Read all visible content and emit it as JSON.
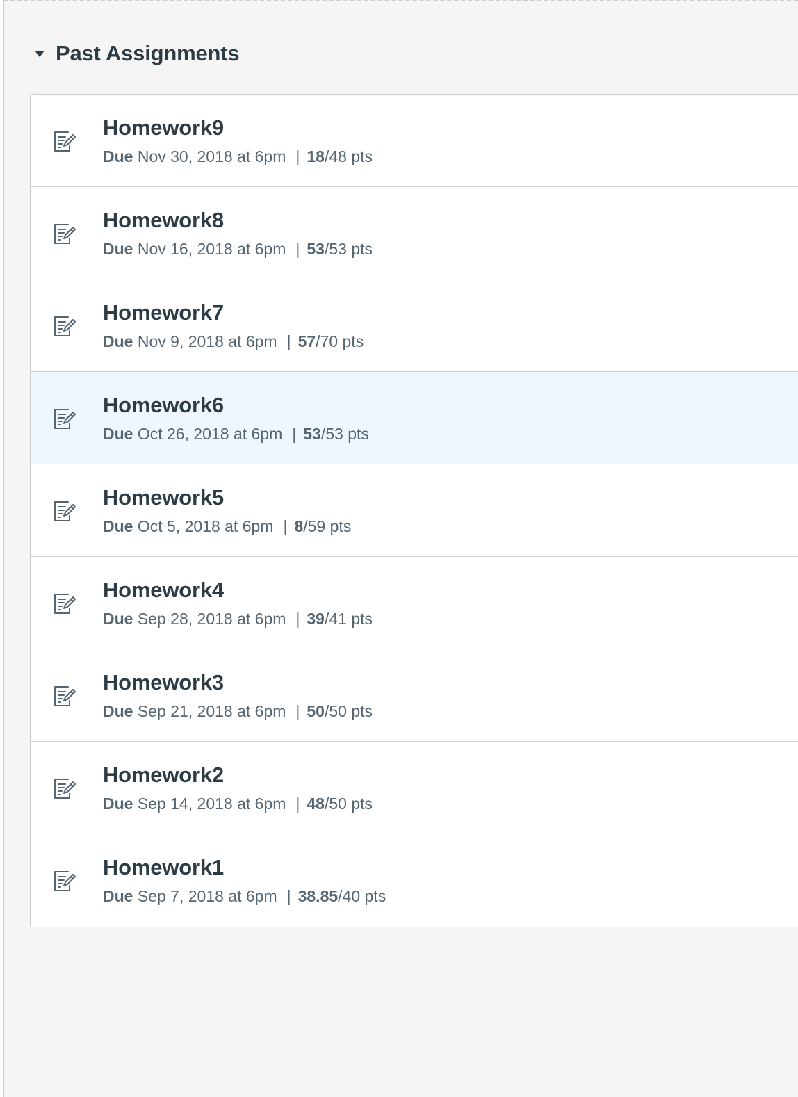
{
  "group": {
    "title": "Past Assignments"
  },
  "assignments": [
    {
      "title": "Homework9",
      "due_label": "Due",
      "due_date": "Nov 30, 2018 at 6pm",
      "separator": "|",
      "score": "18",
      "points": "/48 pts",
      "icon": "assignment-icon"
    },
    {
      "title": "Homework8",
      "due_label": "Due",
      "due_date": "Nov 16, 2018 at 6pm",
      "separator": "|",
      "score": "53",
      "points": "/53 pts",
      "icon": "assignment-icon"
    },
    {
      "title": "Homework7",
      "due_label": "Due",
      "due_date": "Nov 9, 2018 at 6pm",
      "separator": "|",
      "score": "57",
      "points": "/70 pts",
      "icon": "assignment-icon"
    },
    {
      "title": "Homework6",
      "due_label": "Due",
      "due_date": "Oct 26, 2018 at 6pm",
      "separator": "|",
      "score": "53",
      "points": "/53 pts",
      "icon": "assignment-icon",
      "highlighted": true
    },
    {
      "title": "Homework5",
      "due_label": "Due",
      "due_date": "Oct 5, 2018 at 6pm",
      "separator": "|",
      "score": "8",
      "points": "/59 pts",
      "icon": "assignment-icon"
    },
    {
      "title": "Homework4",
      "due_label": "Due",
      "due_date": "Sep 28, 2018 at 6pm",
      "separator": "|",
      "score": "39",
      "points": "/41 pts",
      "icon": "assignment-icon"
    },
    {
      "title": "Homework3",
      "due_label": "Due",
      "due_date": "Sep 21, 2018 at 6pm",
      "separator": "|",
      "score": "50",
      "points": "/50 pts",
      "icon": "assignment-icon"
    },
    {
      "title": "Homework2",
      "due_label": "Due",
      "due_date": "Sep 14, 2018 at 6pm",
      "separator": "|",
      "score": "48",
      "points": "/50 pts",
      "icon": "assignment-icon"
    },
    {
      "title": "Homework1",
      "due_label": "Due",
      "due_date": "Sep 7, 2018 at 6pm",
      "separator": "|",
      "score": "38.85",
      "points": "/40 pts",
      "icon": "assignment-icon"
    }
  ],
  "colors": {
    "text": "#2d3b45",
    "meta": "#556572",
    "highlight": "#eef6fe",
    "border": "#c7cdd1",
    "background": "#f5f5f5"
  }
}
